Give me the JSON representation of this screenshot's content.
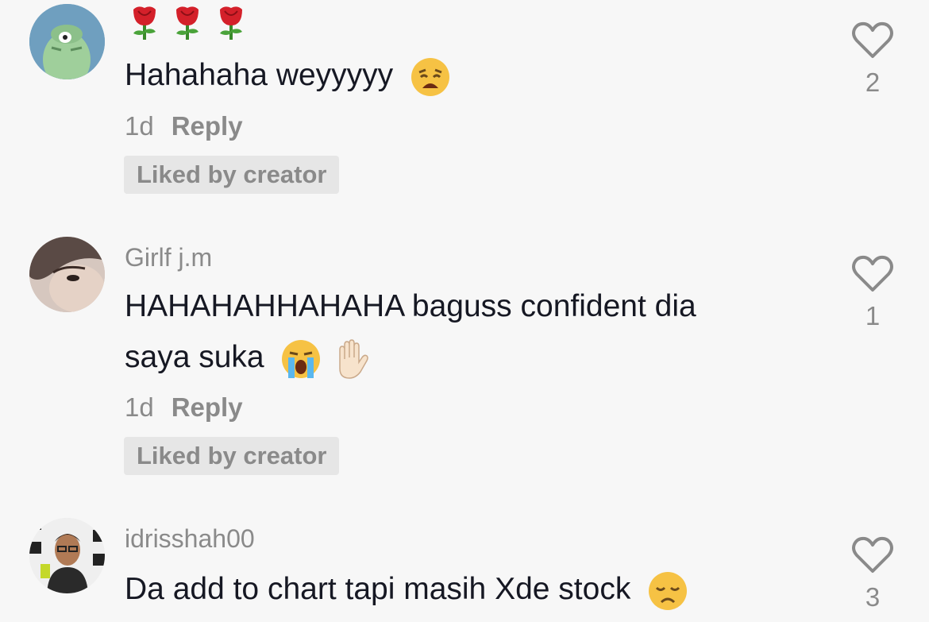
{
  "comments": [
    {
      "username": "",
      "text": "Hahahaha weyyyyy",
      "time": "1d",
      "reply_label": "Reply",
      "liked_badge": "Liked by creator",
      "like_count": "2",
      "avatar_color": "#6f9fbf"
    },
    {
      "username": "Girlf j.m",
      "text_line1": "HAHAHAHHAHAHA baguss confident dia",
      "text_line2": "saya suka",
      "time": "1d",
      "reply_label": "Reply",
      "liked_badge": "Liked by creator",
      "like_count": "1"
    },
    {
      "username": "idrisshah00",
      "text": "Da add to chart tapi masih Xde stock",
      "like_count": "3"
    }
  ],
  "icons": {
    "like": "heart-outline-icon",
    "emoji_weary": "weary-face-emoji",
    "emoji_crying": "loudly-crying-face-emoji",
    "emoji_hand": "raised-hand-emoji",
    "emoji_sad": "disappointed-face-emoji",
    "emoji_rose": "rose-emoji"
  }
}
